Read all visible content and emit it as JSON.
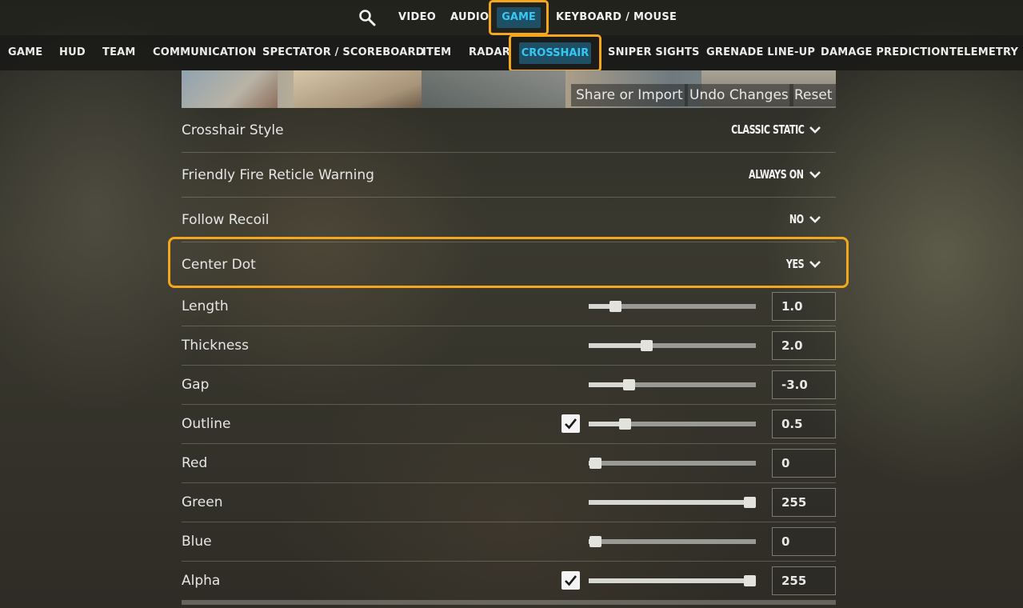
{
  "top_nav": {
    "items": [
      "VIDEO",
      "AUDIO",
      "GAME",
      "KEYBOARD / MOUSE"
    ],
    "active": "GAME"
  },
  "sub_nav": {
    "items": [
      "GAME",
      "HUD",
      "TEAM",
      "COMMUNICATION",
      "SPECTATOR / SCOREBOARD",
      "ITEM",
      "RADAR",
      "CROSSHAIR",
      "SNIPER SIGHTS",
      "GRENADE LINE-UP",
      "DAMAGE PREDICTION",
      "TELEMETRY"
    ],
    "active": "CROSSHAIR"
  },
  "preview": {
    "share_import": "Share or Import",
    "undo_changes": "Undo Changes",
    "reset": "Reset"
  },
  "dropdown_settings": [
    {
      "label": "Crosshair Style",
      "value": "CLASSIC STATIC"
    },
    {
      "label": "Friendly Fire Reticle Warning",
      "value": "ALWAYS ON"
    },
    {
      "label": "Follow Recoil",
      "value": "NO"
    },
    {
      "label": "Center Dot",
      "value": "YES"
    }
  ],
  "slider_settings": [
    {
      "label": "Length",
      "value": "1.0",
      "fraction": 0.13,
      "checkbox": false
    },
    {
      "label": "Thickness",
      "value": "2.0",
      "fraction": 0.33,
      "checkbox": false
    },
    {
      "label": "Gap",
      "value": "-3.0",
      "fraction": 0.22,
      "checkbox": false
    },
    {
      "label": "Outline",
      "value": "0.5",
      "fraction": 0.19,
      "checkbox": true
    },
    {
      "label": "Red",
      "value": "0",
      "fraction": 0.0,
      "checkbox": false
    },
    {
      "label": "Green",
      "value": "255",
      "fraction": 1.0,
      "checkbox": false
    },
    {
      "label": "Blue",
      "value": "0",
      "fraction": 0.0,
      "checkbox": false
    },
    {
      "label": "Alpha",
      "value": "255",
      "fraction": 1.0,
      "checkbox": true
    }
  ],
  "colors": {
    "highlight": "#f4a71c",
    "active_tab_bg": "#1f4f64",
    "active_tab_text": "#36c8f4"
  }
}
